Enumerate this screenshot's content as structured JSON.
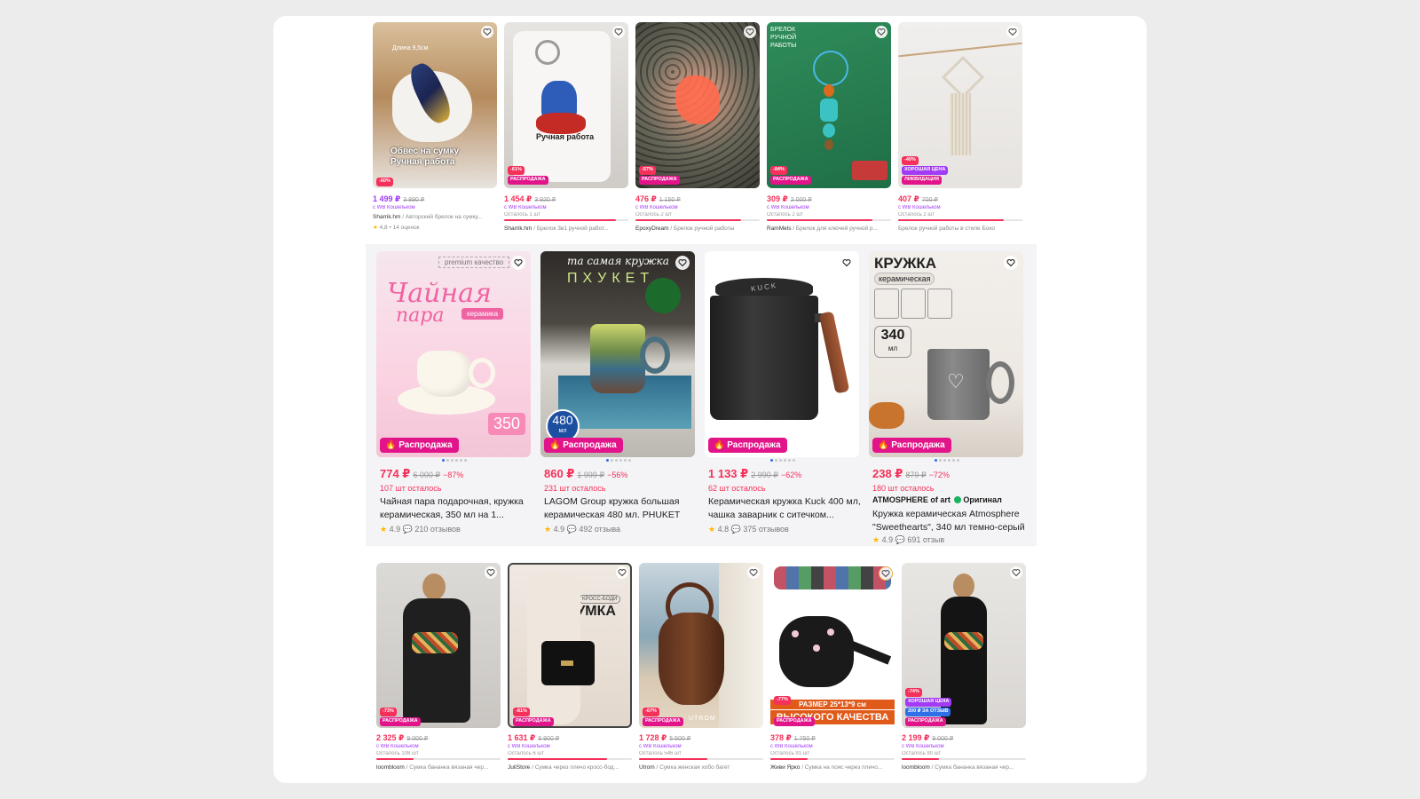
{
  "colors": {
    "accent": "#f5305a",
    "sale": "#e2148a",
    "good_price": "#a13bf5",
    "wallet": "#a13bf5",
    "star": "#ffb800"
  },
  "row1": [
    {
      "img_caption": [
        "Обвес на сумку",
        "Ручная работа"
      ],
      "img_note": "Длина 9,5см",
      "discount": "-60%",
      "badges": [],
      "price": "1 499 ₽",
      "old_price": "3 890 ₽",
      "price_color": "#a13bf5",
      "wallet": "с WB Кошельком",
      "stock": "",
      "progress": 0,
      "seller": "Sharrik.hm",
      "title": "/ Авторский брелок на сумку...",
      "rating": "4,8",
      "reviews": "• 14 оценок"
    },
    {
      "img_caption": [
        "Ручная работа"
      ],
      "img_note": "",
      "discount": "-61%",
      "badges": [
        "РАСПРОДАЖА"
      ],
      "price": "1 454 ₽",
      "old_price": "3 920 ₽",
      "price_color": "#f5305a",
      "wallet": "с WB Кошельком",
      "stock": "Осталось 1 шт",
      "progress": 0.9,
      "seller": "Sharrik.hm",
      "title": "/ Брелок 3в1 ручной работ...",
      "rating": "",
      "reviews": ""
    },
    {
      "img_caption": [],
      "img_note": "",
      "discount": "-57%",
      "badges": [
        "РАСПРОДАЖА"
      ],
      "price": "476 ₽",
      "old_price": "1 150 ₽",
      "price_color": "#f5305a",
      "wallet": "с WB Кошельком",
      "stock": "Осталось 2 шт",
      "progress": 0.85,
      "seller": "EpoxyDream",
      "title": "/ Брелок ручной работы",
      "rating": "",
      "reviews": ""
    },
    {
      "img_caption": [
        "БРЕЛОК",
        "РУЧНОЙ",
        "РАБОТЫ"
      ],
      "img_note": "",
      "discount": "-84%",
      "badges": [
        "РАСПРОДАЖА"
      ],
      "price": "309 ₽",
      "old_price": "2 000 ₽",
      "price_color": "#f5305a",
      "wallet": "с WB Кошельком",
      "stock": "Осталось 2 шт",
      "progress": 0.85,
      "seller": "RamMels",
      "title": "/ Брелок для ключей ручной р...",
      "rating": "",
      "reviews": ""
    },
    {
      "img_caption": [],
      "img_note": "",
      "discount": "-40%",
      "badges": [
        "ХОРОШАЯ ЦЕНА",
        "ЛИКВИДАЦИЯ"
      ],
      "price": "407 ₽",
      "old_price": "700 ₽",
      "price_color": "#f5305a",
      "wallet": "с WB Кошельком",
      "stock": "Осталось 2 шт",
      "progress": 0.85,
      "seller": "",
      "title": "Брелок ручной работы в стиле Бохо",
      "rating": "",
      "reviews": ""
    }
  ],
  "row2": [
    {
      "img_lines": [
        "premium качество",
        "Чайная",
        "пара",
        "керамика",
        "350"
      ],
      "sale_label": "Распродажа",
      "price": "774 ₽",
      "old_price": "6 000 ₽",
      "pct": "−87%",
      "stock": "107 шт осталось",
      "brand": "",
      "title": "Чайная пара подарочная, кружка керамическая, 350 мл на 1...",
      "rating": "4.9",
      "reviews": "210 отзывов"
    },
    {
      "img_lines": [
        "та самая кружка",
        "ПХУКЕТ",
        "480",
        "мл"
      ],
      "sale_label": "Распродажа",
      "price": "860 ₽",
      "old_price": "1 999 ₽",
      "pct": "−56%",
      "stock": "231 шт осталось",
      "brand": "",
      "title": "LAGOM Group кружка большая керамическая 480 мл. PHUKET",
      "rating": "4.9",
      "reviews": "492 отзыва"
    },
    {
      "img_lines": [
        "KUCK"
      ],
      "sale_label": "Распродажа",
      "price": "1 133 ₽",
      "old_price": "2 990 ₽",
      "pct": "−62%",
      "stock": "62 шт осталось",
      "brand": "",
      "title": "Керамическая кружка Kuck 400 мл, чашка заварник с ситечком...",
      "rating": "4.8",
      "reviews": "375 отзывов"
    },
    {
      "img_lines": [
        "КРУЖКА",
        "керамическая",
        "340",
        "мл"
      ],
      "sale_label": "Распродажа",
      "price": "238 ₽",
      "old_price": "879 ₽",
      "pct": "−72%",
      "stock": "180 шт осталось",
      "brand": "ATMOSPHERE of art",
      "brand_tag": "Оригинал",
      "title": "Кружка керамическая Atmosphere \"Sweethearts\", 340 мл темно-серый",
      "rating": "4.9",
      "reviews": "691 отзыв"
    }
  ],
  "row3": [
    {
      "discount": "-73%",
      "badges": [
        "РАСПРОДАЖА"
      ],
      "price": "2 325 ₽",
      "old_price": "9 000 ₽",
      "wallet": "с WB Кошельком",
      "stock": "Осталось 108 шт",
      "progress": 0.3,
      "seller": "loombloom",
      "title": "/ Сумка бананка вязаная чер...",
      "img_lines": []
    },
    {
      "discount": "-81%",
      "badges": [
        "РАСПРОДАЖА"
      ],
      "price": "1 631 ₽",
      "old_price": "8 900 ₽",
      "wallet": "с WB Кошельком",
      "stock": "Осталось 6 шт",
      "progress": 0.8,
      "seller": "JuliStore",
      "title": "/ Сумка через плечо кросс-бод...",
      "img_lines": [
        "КРОСС-БОДИ",
        "СУМКА"
      ]
    },
    {
      "discount": "-67%",
      "badges": [
        "РАСПРОДАЖА"
      ],
      "price": "1 728 ₽",
      "old_price": "5 500 ₽",
      "wallet": "с WB Кошельком",
      "stock": "Осталось 546 шт",
      "progress": 0.55,
      "seller": "Utrom",
      "title": "/ Сумка женская хобо багет",
      "img_lines": [
        "UTROM"
      ]
    },
    {
      "discount": "-77%",
      "badges": [
        "РАСПРОДАЖА"
      ],
      "price": "378 ₽",
      "old_price": "1 750 ₽",
      "wallet": "с WB Кошельком",
      "stock": "Осталось 91 шт",
      "progress": 0.3,
      "seller": "Живи Ярко",
      "title": "/ Сумка на пояс через плечо...",
      "img_lines": [
        "РАЗМЕР 25*13*9 см",
        "ВЫСОКОГО КАЧЕСТВА"
      ]
    },
    {
      "discount": "-74%",
      "badges": [
        "ХОРОШАЯ ЦЕНА",
        "200 ₽ ЗА ОТЗЫВ",
        "РАСПРОДАЖА"
      ],
      "price": "2 199 ₽",
      "old_price": "9 000 ₽",
      "wallet": "с WB Кошельком",
      "stock": "Осталось 90 шт",
      "progress": 0.3,
      "seller": "loombloom",
      "title": "/ Сумка бананка вязаная чер...",
      "img_lines": []
    }
  ]
}
